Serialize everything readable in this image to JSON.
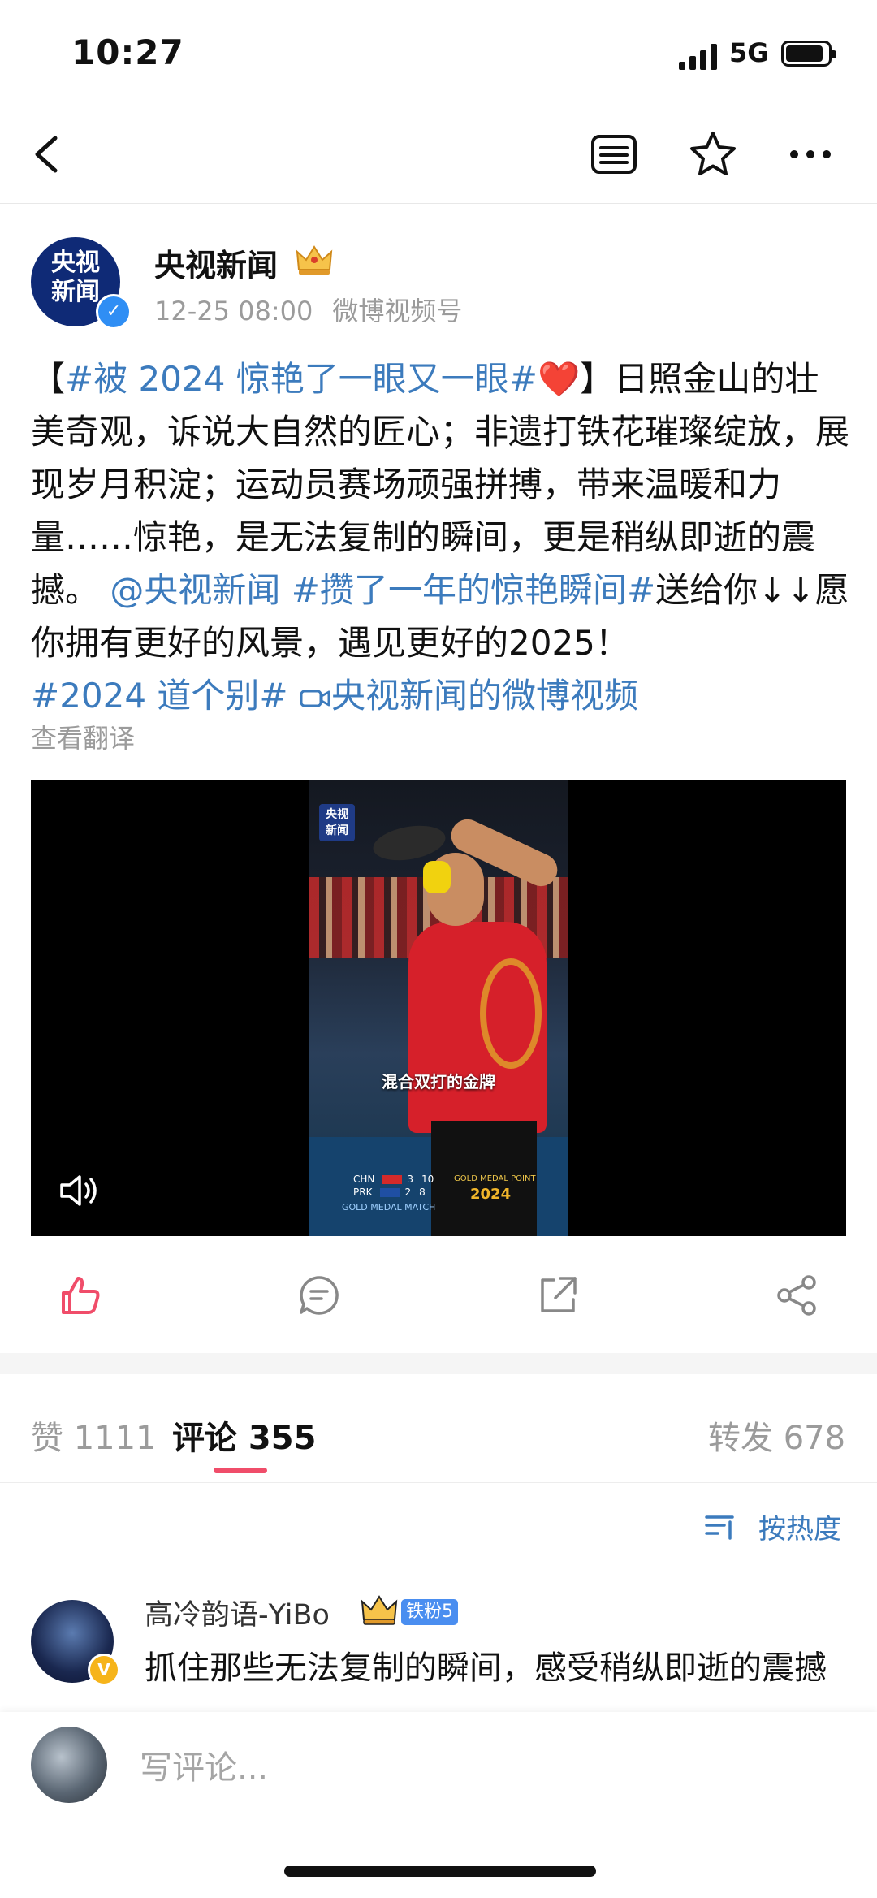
{
  "status_bar": {
    "time": "10:27",
    "network": "5G"
  },
  "post": {
    "author": "央视新闻",
    "avatar_text": [
      "央视",
      "新闻"
    ],
    "time": "12-25 08:00",
    "source": "微博视频号",
    "text": {
      "tag_open": "【",
      "tag1": "#被 2024 惊艳了一眼又一眼#",
      "heart": "❤️",
      "tag_close": "】",
      "body1": "日照金山的壮美奇观，诉说大自然的匠心；非遗打铁花璀璨绽放，展现岁月积淀；运动员赛场顽强拼搏，带来温暖和力量……惊艳，是无法复制的瞬间，更是稍纵即逝的震撼。",
      "mention": "@央视新闻",
      "tag2": "#攒了一年的惊艳瞬间#",
      "body2": "送给你↓↓愿你拥有更好的风景，遇见更好的2025！",
      "tag3": "#2024 道个别#",
      "video_link": "央视新闻的微博视频"
    },
    "translate": "查看翻译"
  },
  "video": {
    "logo": [
      "央视",
      "新闻"
    ],
    "caption": "混合双打的金牌",
    "score": {
      "team1": "CHN",
      "team1_games": "3",
      "team1_points": "10",
      "team2": "PRK",
      "team2_games": "2",
      "team2_points": "8"
    },
    "gold_point": "GOLD MEDAL POINT",
    "gold_match": "GOLD MEDAL MATCH",
    "year": "2024"
  },
  "tabs": {
    "likes": "赞 1111",
    "comments": "评论 355",
    "reposts": "转发 678"
  },
  "sort": {
    "label": "按热度"
  },
  "comment": {
    "user": "高冷韵语-YiBo",
    "badge": "铁粉5",
    "text": "抓住那些无法复制的瞬间，感受稍纵即逝的震撼"
  },
  "composer": {
    "placeholder": "写评论..."
  },
  "colors": {
    "link": "#3c7bbd",
    "accent": "#f04d6a",
    "like": "#f04d6a"
  }
}
